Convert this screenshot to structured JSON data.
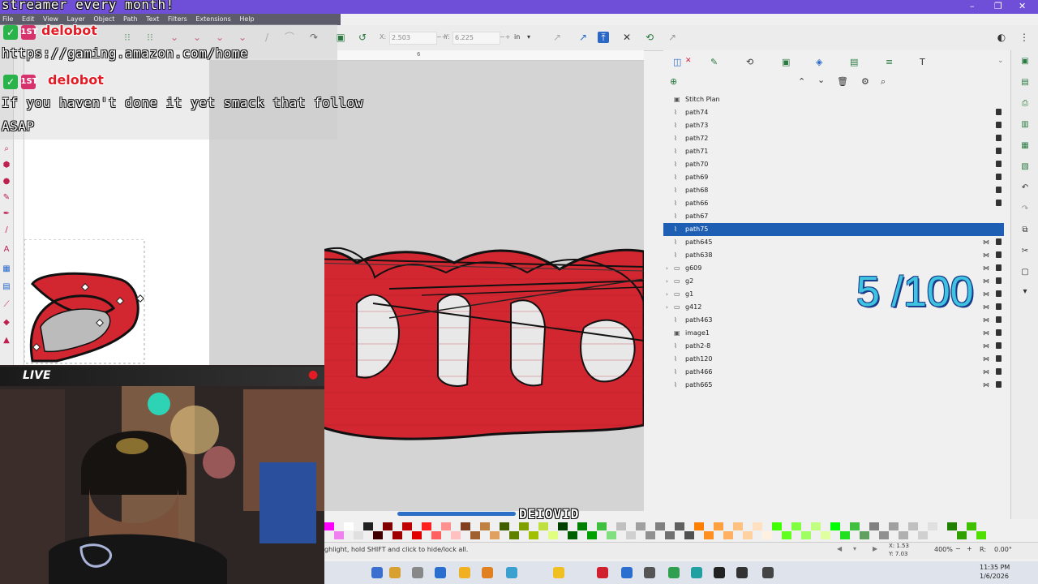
{
  "chat": {
    "line_top": "streamer every month!",
    "msg1_user": "delobot",
    "msg1_text": "https://gaming.amazon.com/home",
    "msg2_user": "delobot",
    "msg2_text_1": "If you haven't done it yet smack that follow",
    "msg2_text_2": "ASAP",
    "badge_first": "1ST"
  },
  "menubar": [
    "File",
    "Edit",
    "View",
    "Layer",
    "Object",
    "Path",
    "Text",
    "Filters",
    "Extensions",
    "Help"
  ],
  "controls": {
    "x_label": "X:",
    "x_value": "2.503",
    "y_label": "Y:",
    "y_value": "6.225",
    "unit": "in"
  },
  "ruler": {
    "tick": "6"
  },
  "webcam": {
    "live_label": "LIVE"
  },
  "layers_panel": {
    "rows": [
      {
        "label": "Stitch Plan",
        "type": "layer",
        "lock": false,
        "eye": false,
        "selected": false
      },
      {
        "label": "path74",
        "type": "path",
        "lock": true,
        "eye": false,
        "selected": false
      },
      {
        "label": "path73",
        "type": "path",
        "lock": true,
        "eye": false,
        "selected": false
      },
      {
        "label": "path72",
        "type": "path",
        "lock": true,
        "eye": false,
        "selected": false
      },
      {
        "label": "path71",
        "type": "path",
        "lock": true,
        "eye": false,
        "selected": false
      },
      {
        "label": "path70",
        "type": "path",
        "lock": true,
        "eye": false,
        "selected": false
      },
      {
        "label": "path69",
        "type": "path",
        "lock": true,
        "eye": false,
        "selected": false
      },
      {
        "label": "path68",
        "type": "path",
        "lock": true,
        "eye": false,
        "selected": false
      },
      {
        "label": "path66",
        "type": "path",
        "lock": true,
        "eye": false,
        "selected": false
      },
      {
        "label": "path67",
        "type": "path",
        "lock": false,
        "eye": false,
        "selected": false
      },
      {
        "label": "path75",
        "type": "path",
        "lock": false,
        "eye": false,
        "selected": true
      },
      {
        "label": "path645",
        "type": "path",
        "lock": true,
        "eye": true,
        "selected": false
      },
      {
        "label": "path638",
        "type": "path",
        "lock": true,
        "eye": true,
        "selected": false
      },
      {
        "label": "g609",
        "type": "group",
        "lock": true,
        "eye": true,
        "selected": false
      },
      {
        "label": "g2",
        "type": "group",
        "lock": true,
        "eye": true,
        "selected": false
      },
      {
        "label": "g1",
        "type": "group",
        "lock": true,
        "eye": true,
        "selected": false
      },
      {
        "label": "g412",
        "type": "group",
        "lock": true,
        "eye": true,
        "selected": false
      },
      {
        "label": "path463",
        "type": "path",
        "lock": true,
        "eye": true,
        "selected": false
      },
      {
        "label": "image1",
        "type": "image",
        "lock": true,
        "eye": true,
        "selected": false
      },
      {
        "label": "path2-8",
        "type": "path",
        "lock": true,
        "eye": true,
        "selected": false
      },
      {
        "label": "path120",
        "type": "path",
        "lock": true,
        "eye": true,
        "selected": false
      },
      {
        "label": "path466",
        "type": "path",
        "lock": true,
        "eye": true,
        "selected": false
      },
      {
        "label": "path665",
        "type": "path",
        "lock": true,
        "eye": true,
        "selected": false
      }
    ]
  },
  "counter": "5 /100",
  "overlay_name": "DEIOVID",
  "statusbar": {
    "hint": "ghlight, hold SHIFT and click to hide/lock all.",
    "x_readout": "X: 1.53",
    "y_readout": "Y: 7.03",
    "zoom": "400%",
    "rotation": "0.00°",
    "r_label": "R:"
  },
  "clock": {
    "time": "11:35 PM",
    "date": "1/6/2026"
  },
  "colors": {
    "accent_titlebar": "#6f4fd8",
    "selection": "#1e5fb3",
    "counter": "#3ec3e0",
    "embroidery_red": "#d22630"
  },
  "icons": [
    "search-icon",
    "gear-icon",
    "trash-icon",
    "chevron-up-icon",
    "chevron-down-icon",
    "lock-icon",
    "eye-icon",
    "layers-icon",
    "close-icon"
  ]
}
